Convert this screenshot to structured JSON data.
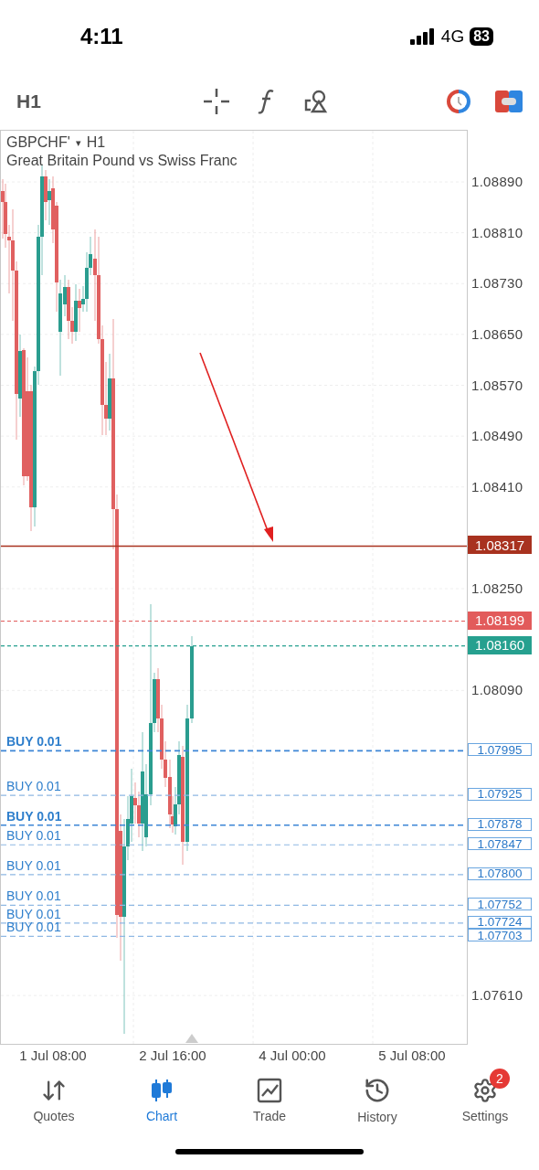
{
  "status_bar": {
    "time": "4:11",
    "network": "4G",
    "battery": "83"
  },
  "toolbar": {
    "timeframe": "H1"
  },
  "chart": {
    "symbol": "GBPCHF'",
    "dropdown": "▾",
    "timeframe": "H1",
    "description": "Great Britain Pound vs Swiss Franc",
    "price_axis": [
      "1.08890",
      "1.08810",
      "1.08730",
      "1.08650",
      "1.08570",
      "1.08490",
      "1.08410",
      "1.08250",
      "1.08090",
      "1.07610"
    ],
    "price_lines": [
      {
        "kind": "solid",
        "price": "1.08317",
        "color": "#a8321f"
      },
      {
        "kind": "dotted",
        "price": "1.08199",
        "color": "#e25b5b"
      },
      {
        "kind": "dotted",
        "price": "1.08160",
        "color": "#26a08f"
      }
    ],
    "orders": [
      {
        "label": "BUY 0.01",
        "price": "1.07995",
        "emphasized": true
      },
      {
        "label": "BUY 0.01",
        "price": "1.07925",
        "emphasized": false
      },
      {
        "label": "BUY 0.01",
        "price": "1.07878",
        "emphasized": true
      },
      {
        "label": "BUY 0.01",
        "price": "1.07847",
        "emphasized": false
      },
      {
        "label": "BUY 0.01",
        "price": "1.07800",
        "emphasized": false
      },
      {
        "label": "BUY 0.01",
        "price": "1.07752",
        "emphasized": false
      },
      {
        "label": "BUY 0.01",
        "price": "1.07724",
        "emphasized": false
      },
      {
        "label": "BUY 0.01",
        "price": "1.07703",
        "emphasized": false
      }
    ],
    "time_axis": [
      "1 Jul 08:00",
      "2 Jul 16:00",
      "4 Jul 00:00",
      "5 Jul 08:00"
    ]
  },
  "tabs": [
    {
      "label": "Quotes",
      "selected": false
    },
    {
      "label": "Chart",
      "selected": true
    },
    {
      "label": "Trade",
      "selected": false
    },
    {
      "label": "History",
      "selected": false
    },
    {
      "label": "Settings",
      "selected": false,
      "badge": "2"
    }
  ]
}
